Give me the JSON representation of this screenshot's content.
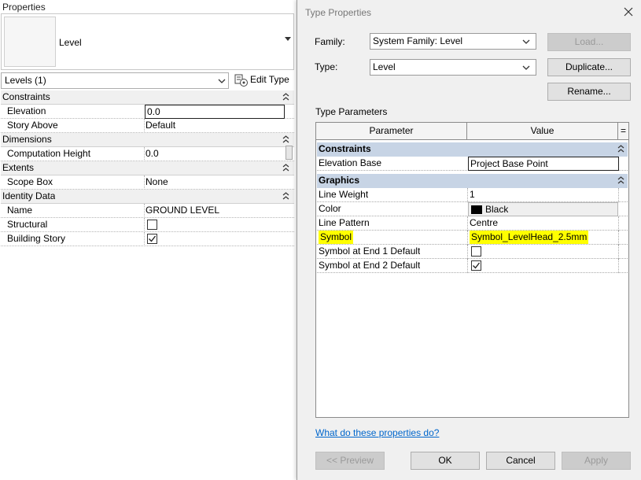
{
  "properties": {
    "title": "Properties",
    "type_name": "Level",
    "instance_selector": "Levels (1)",
    "edit_type_label": "Edit Type",
    "groups": [
      {
        "name": "Constraints",
        "rows": [
          {
            "name": "Elevation",
            "value": "0.0"
          },
          {
            "name": "Story Above",
            "value": "Default"
          }
        ]
      },
      {
        "name": "Dimensions",
        "rows": [
          {
            "name": "Computation Height",
            "value": "0.0"
          }
        ]
      },
      {
        "name": "Extents",
        "rows": [
          {
            "name": "Scope Box",
            "value": "None"
          }
        ]
      },
      {
        "name": "Identity Data",
        "rows": [
          {
            "name": "Name",
            "value": "GROUND LEVEL"
          },
          {
            "name": "Structural",
            "checked": false
          },
          {
            "name": "Building Story",
            "checked": true
          }
        ]
      }
    ]
  },
  "dialog": {
    "title": "Type Properties",
    "family_label": "Family:",
    "family_value": "System Family: Level",
    "type_label": "Type:",
    "type_value": "Level",
    "load_button": "Load...",
    "duplicate_button": "Duplicate...",
    "rename_button": "Rename...",
    "type_parameters_label": "Type Parameters",
    "grid": {
      "col_parameter": "Parameter",
      "col_value": "Value",
      "col_extra": "=",
      "groups": [
        {
          "name": "Constraints",
          "rows": [
            {
              "name": "Elevation Base",
              "value": "Project Base Point"
            }
          ]
        },
        {
          "name": "Graphics",
          "rows": [
            {
              "name": "Line Weight",
              "value": "1"
            },
            {
              "name": "Color",
              "value": "Black"
            },
            {
              "name": "Line Pattern",
              "value": "Centre"
            },
            {
              "name": "Symbol",
              "value": "Symbol_LevelHead_2.5mm"
            },
            {
              "name": "Symbol at End 1 Default",
              "checked": false
            },
            {
              "name": "Symbol at End 2 Default",
              "checked": true
            }
          ]
        }
      ]
    },
    "help_link": "What do these properties do?",
    "preview_button": "<< Preview",
    "ok_button": "OK",
    "cancel_button": "Cancel",
    "apply_button": "Apply"
  },
  "colors": {
    "highlight": "#ffff00",
    "group_header": "#c7d4e5",
    "link": "#0066cc",
    "swatch": "#000000"
  }
}
